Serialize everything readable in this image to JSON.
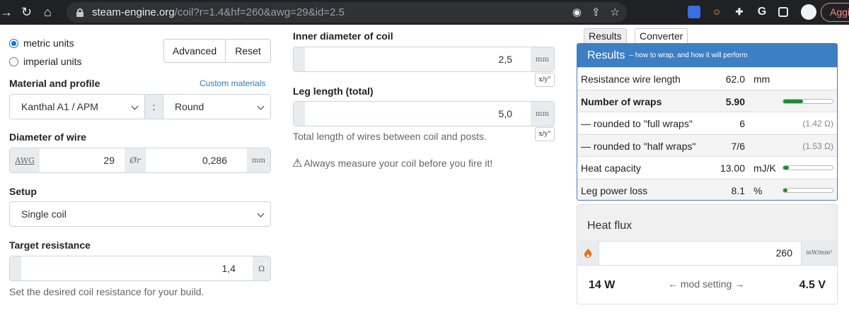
{
  "browser": {
    "url_host": "steam-engine.org",
    "url_path": "/coil?r=1.4&hf=260&awg=29&id=2.5",
    "profile_label": "Aggi"
  },
  "units": {
    "metric": "metric units",
    "imperial": "imperial units",
    "selected": "metric"
  },
  "buttons": {
    "advanced": "Advanced",
    "reset": "Reset"
  },
  "material": {
    "heading": "Material and profile",
    "custom_link": "Custom materials",
    "material_value": "Kanthal A1 / APM",
    "separator": ":",
    "profile_value": "Round"
  },
  "wire": {
    "heading": "Diameter of wire",
    "awg_label": "AWG",
    "awg_value": "29",
    "diam_label": "Ør",
    "diam_value": "0,286",
    "diam_unit": "mm"
  },
  "setup": {
    "heading": "Setup",
    "value": "Single coil"
  },
  "target": {
    "heading": "Target resistance",
    "value": "1,4",
    "unit": "Ω",
    "help": "Set the desired coil resistance for your build."
  },
  "inner": {
    "heading": "Inner diameter of coil",
    "value": "2,5",
    "unit": "mm",
    "xy": "x/y\""
  },
  "leg": {
    "heading": "Leg length (total)",
    "value": "5,0",
    "unit": "mm",
    "xy": "x/y\"",
    "help": "Total length of wires between coil and posts."
  },
  "warning": "Always measure your coil before you fire it!",
  "tabs": {
    "results": "Results",
    "converter": "Converter"
  },
  "results": {
    "title": "Results",
    "subtitle": "– how to wrap, and how it will perform",
    "rows": [
      {
        "key": "Resistance wire length",
        "value": "62.0",
        "unit": "mm",
        "note": "",
        "bar": null,
        "bold": false
      },
      {
        "key": "Number of wraps",
        "value": "5.90",
        "unit": "",
        "note": "",
        "bar": 0.4,
        "bold": true
      },
      {
        "key": "— rounded to \"full wraps\"",
        "value": "6",
        "unit": "",
        "note": "(1.42 Ω)",
        "bar": null,
        "bold": false
      },
      {
        "key": "— rounded to \"half wraps\"",
        "value": "7/6",
        "unit": "",
        "note": "(1.53 Ω)",
        "bar": null,
        "bold": false
      },
      {
        "key": "Heat capacity",
        "value": "13.00",
        "unit": "mJ/K",
        "note": "",
        "bar": 0.12,
        "bold": false
      },
      {
        "key": "Leg power loss",
        "value": "8.1",
        "unit": "%",
        "note": "",
        "bar": 0.08,
        "bold": false
      }
    ]
  },
  "flux": {
    "title": "Heat flux",
    "value": "260",
    "unit": "mW/mm²",
    "watts": "14 W",
    "mod_setting": "← mod setting →",
    "volts": "4.5 V"
  },
  "colors": {
    "accent": "#3d7fc4",
    "bar": "#1e8a2e"
  }
}
